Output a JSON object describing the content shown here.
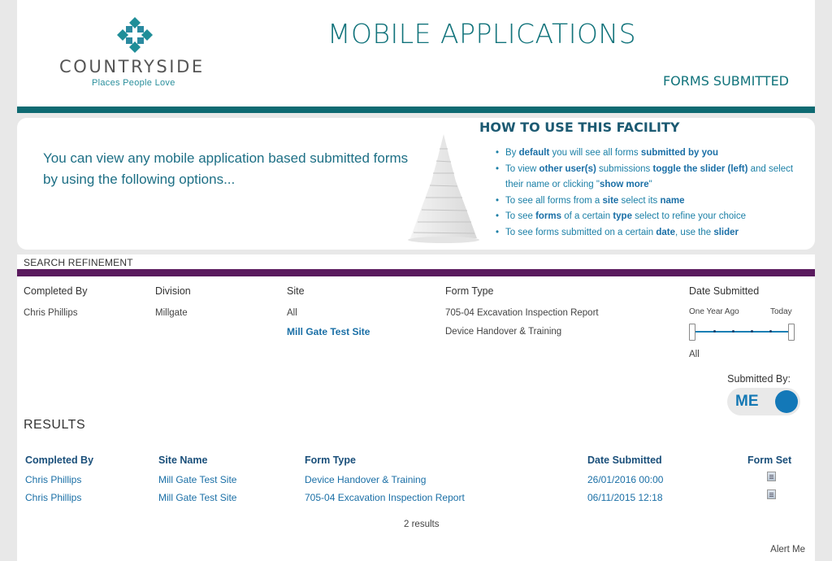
{
  "header": {
    "logo_name": "COUNTRYSIDE",
    "logo_tagline": "Places People Love",
    "title": "MOBILE APPLICATIONS",
    "section": "FORMS SUBMITTED",
    "accent": "#0e6a72"
  },
  "info": {
    "intro": "You can view any mobile application based submitted forms by using the following options...",
    "howto_title": "HOW TO USE THIS FACILITY"
  },
  "search": {
    "label": "SEARCH REFINEMENT",
    "bar_color": "#5a1a5e",
    "columns": {
      "completed_by": "Completed By",
      "division": "Division",
      "site": "Site",
      "form_type": "Form Type",
      "date_submitted": "Date Submitted"
    },
    "values": {
      "completed_by": "Chris Phillips",
      "division": "Millgate",
      "site_all": "All",
      "site_selected": "Mill Gate Test Site",
      "form_type_1": "705-04 Excavation Inspection Report",
      "form_type_2": "Device Handover & Training"
    },
    "slider": {
      "left_label": "One Year Ago",
      "right_label": "Today",
      "value_label": "All"
    },
    "submitted_by_label": "Submitted By:",
    "toggle_text": "ME"
  },
  "results": {
    "title": "RESULTS",
    "headers": {
      "completed_by": "Completed By",
      "site_name": "Site Name",
      "form_type": "Form Type",
      "date_submitted": "Date Submitted",
      "form_set": "Form Set"
    },
    "rows": [
      {
        "completed_by": "Chris Phillips",
        "site_name": "Mill Gate Test Site",
        "form_type": "Device Handover & Training",
        "date": "26/01/2016 00:00",
        "form_set_icon": "document-icon"
      },
      {
        "completed_by": "Chris Phillips",
        "site_name": "Mill Gate Test Site",
        "form_type": "705-04 Excavation Inspection Report",
        "date": "06/11/2015 12:18",
        "form_set_icon": "document-icon"
      }
    ],
    "count": "2 results",
    "alert": "Alert Me"
  }
}
